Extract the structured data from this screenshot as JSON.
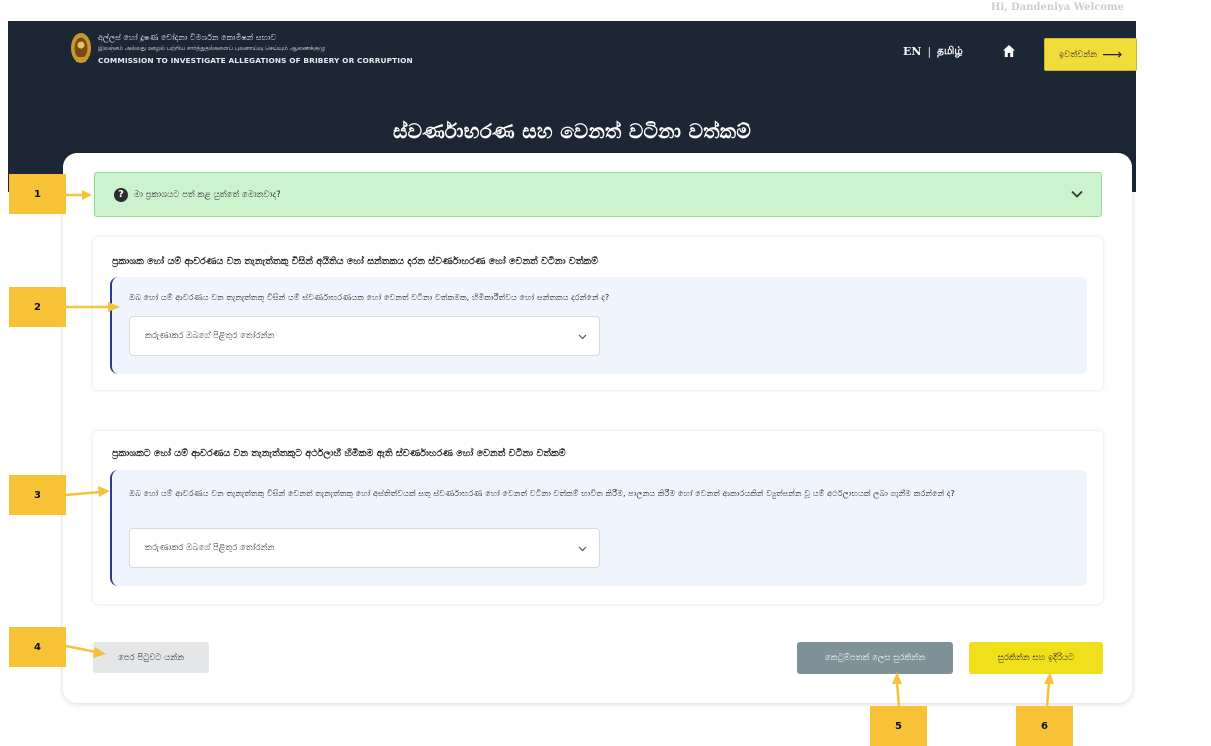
{
  "header": {
    "user_greeting": "Hi, Dandeniya Welcome",
    "org_name_sinhala": "අල්ලස් හෝ දූෂණ චෝදනා විමර්ශන කොමිෂන් සභාව",
    "org_name_tamil": "இலஞ்சம் அல்லது ஊழல் பற்றிய சார்த்துதல்களைப் புலனாய்வு செய்யும் ஆணைக்குழு",
    "org_name_english": "COMMISSION TO INVESTIGATE ALLEGATIONS OF BRIBERY OR CORRUPTION",
    "lang_en": "EN",
    "lang_separator": "|",
    "lang_ta": "தமிழ்",
    "home_icon": "home-icon",
    "logout_label": "ඉවත්වන්න",
    "logout_arrow": "⟶",
    "page_title": "ස්වර්ණාභරණ සහ වෙනත් වටිනා වත්කම්"
  },
  "help": {
    "label": "මා ප්‍රකාශයට පත් කළ යුත්තේ මොනවාද?",
    "icon": "question-circle-icon",
    "toggle_icon": "chevron-down-icon"
  },
  "sections": [
    {
      "title": "ප්‍රකාශක හෝ යම් ආවරණය වන තැනැත්තකු විසින් අයිතිය හෝ සන්තකය දරන ස්වර්ණාභරණ හෝ වෙනත් වටිනා වත්කම්",
      "question": "ඔබ හෝ යම් ආවරණය වන තැනැත්තකු විසින් යම් ස්වර්ණාභරණයක හෝ වෙනත් වටිනා වත්කමක, හිමිකාරීත්වය හෝ සන්තකය දරන්නේ ද?",
      "select_placeholder": "කරුණාකර ඔබගේ පිළිතුර තෝරන්න"
    },
    {
      "title": "ප්‍රකාශකට හෝ යම් ආවරණය වන තැනැත්තකුට අර්ථලාභී හිමිකම ඇති ස්වර්ණාභරණ හෝ වෙනත් වටිනා වත්කම්",
      "question": "ඔබ හෝ යම් ආවරණය වන තැනැත්තකු විසින් වෙනත් තැනැත්තකු හෝ අස්තිත්වයක් සතු ස්වර්ණාභරණ හෝ වෙනත් වටිනා වත්කම් භාවිත කිරීම, පාලනය කිරීම හෝ වෙනත් ආකාරයකින් ව්‍යුත්පන්න වූ යම් අර්ථලාභයක් ලබා ගැනීම කරන්නේ ද?",
      "select_placeholder": "කරුණාකර ඔබගේ පිළිතුර තෝරන්න"
    }
  ],
  "buttons": {
    "back": "පෙර පිටුවට යන්න",
    "save_draft": "කෙටුම්පතක් ලෙස සුරකින්න",
    "save_next": "සුරකින්න සහ ඉදිරියට"
  },
  "annotations": [
    "1",
    "2",
    "3",
    "4",
    "5",
    "6"
  ],
  "colors": {
    "header_bg": "#1c2635",
    "accent_yellow": "#f0df1b",
    "help_bg": "#ccf3ce",
    "badge": "#f7c236"
  }
}
